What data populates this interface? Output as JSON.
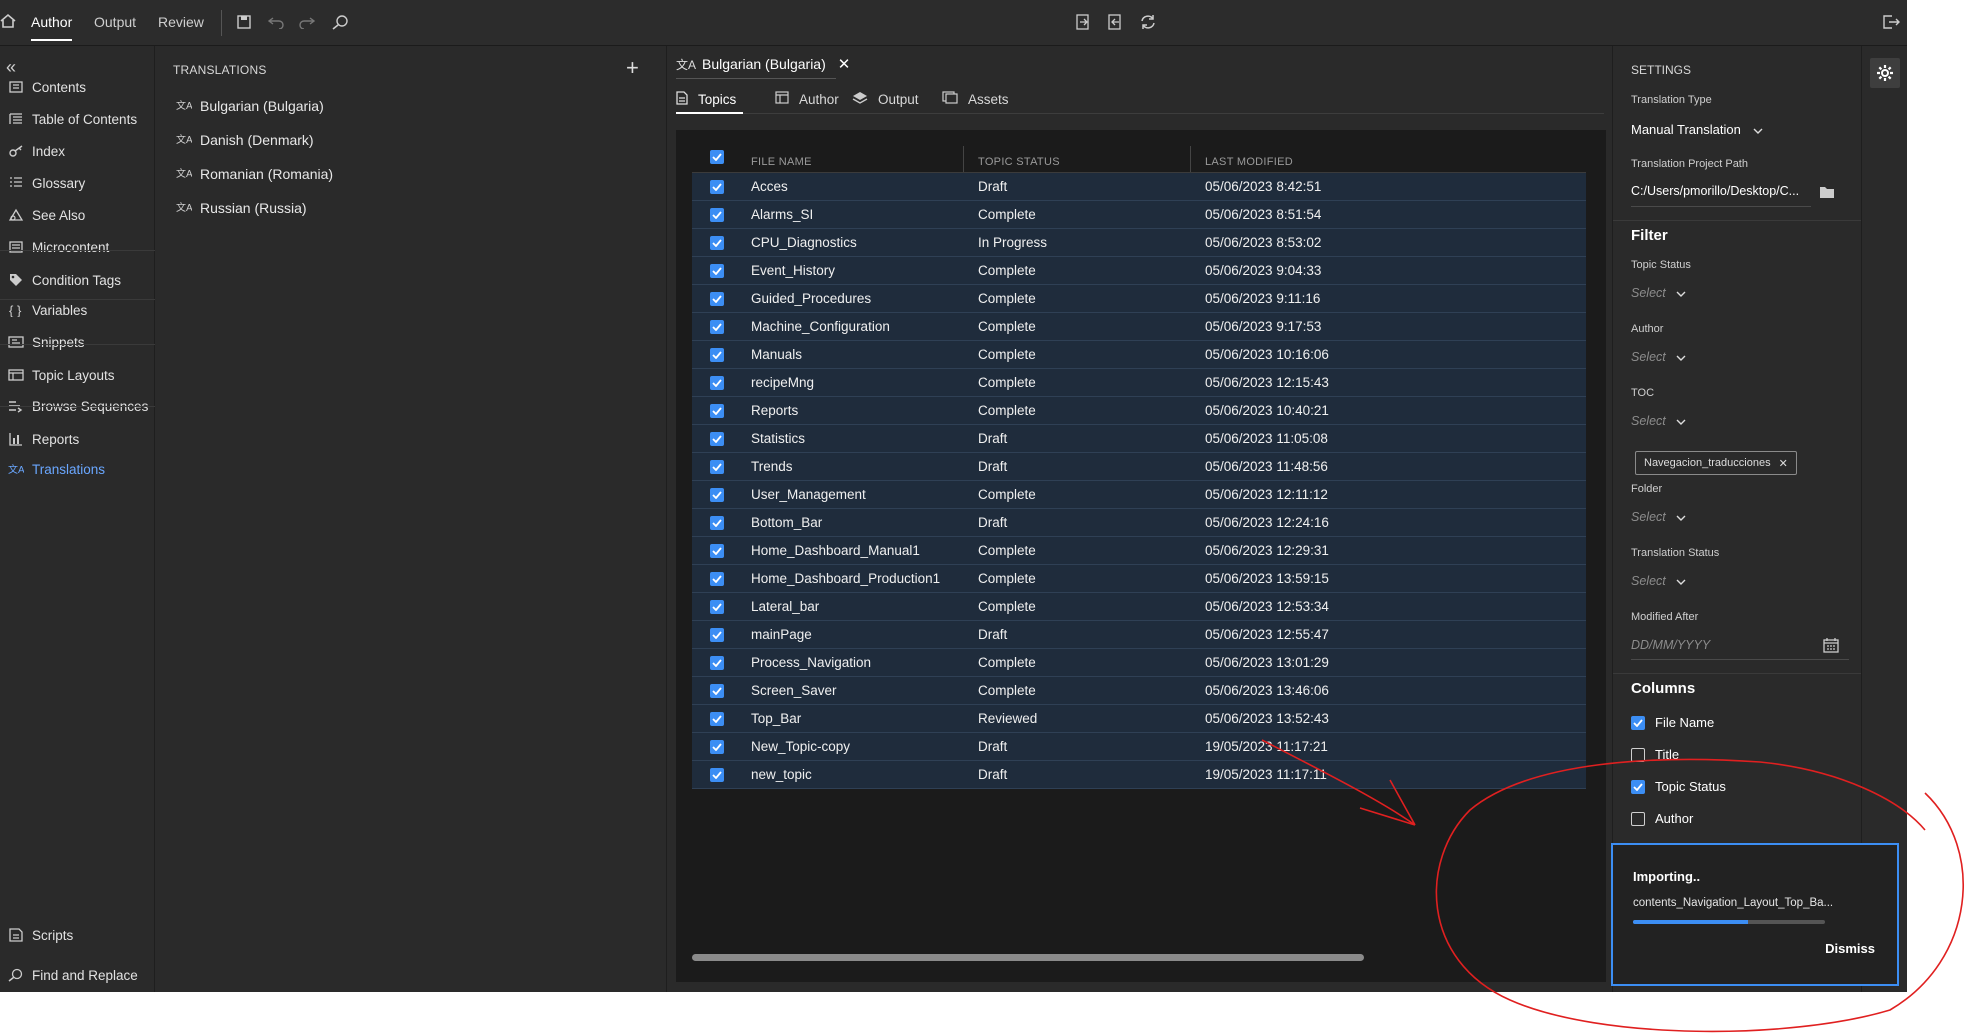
{
  "topbar": {
    "tabs": [
      "Author",
      "Output",
      "Review"
    ],
    "active_tab": "Author"
  },
  "leftnav": {
    "items": [
      {
        "label": "Contents",
        "icon": "contents-icon"
      },
      {
        "label": "Table of Contents",
        "icon": "toc-icon"
      },
      {
        "label": "Index",
        "icon": "index-icon"
      },
      {
        "label": "Glossary",
        "icon": "glossary-icon"
      },
      {
        "label": "See Also",
        "icon": "see-also-icon"
      },
      {
        "label": "Microcontent",
        "icon": "microcontent-icon"
      },
      {
        "label": "Condition Tags",
        "icon": "tag-icon"
      },
      {
        "label": "Variables",
        "icon": "variables-icon"
      },
      {
        "label": "Snippets",
        "icon": "snippets-icon"
      },
      {
        "label": "Topic Layouts",
        "icon": "layouts-icon"
      },
      {
        "label": "Browse Sequences",
        "icon": "sequence-icon"
      },
      {
        "label": "Reports",
        "icon": "reports-icon"
      },
      {
        "label": "Translations",
        "icon": "translate-icon"
      }
    ],
    "active": "Translations",
    "bottom_items": [
      {
        "label": "Scripts",
        "icon": "scripts-icon"
      },
      {
        "label": "Find and Replace",
        "icon": "find-replace-icon"
      }
    ]
  },
  "translations": {
    "heading": "TRANSLATIONS",
    "items": [
      "Bulgarian (Bulgaria)",
      "Danish (Denmark)",
      "Romanian (Romania)",
      "Russian (Russia)"
    ]
  },
  "center": {
    "doc_tab": "Bulgarian (Bulgaria)",
    "sub_tabs": [
      "Topics",
      "Author",
      "Output",
      "Assets"
    ],
    "active_sub_tab": "Topics",
    "columns": [
      "FILE NAME",
      "TOPIC STATUS",
      "LAST MODIFIED"
    ],
    "rows": [
      {
        "name": "Acces",
        "status": "Draft",
        "modified": "05/06/2023 8:42:51"
      },
      {
        "name": "Alarms_SI",
        "status": "Complete",
        "modified": "05/06/2023 8:51:54"
      },
      {
        "name": "CPU_Diagnostics",
        "status": "In Progress",
        "modified": "05/06/2023 8:53:02"
      },
      {
        "name": "Event_History",
        "status": "Complete",
        "modified": "05/06/2023 9:04:33"
      },
      {
        "name": "Guided_Procedures",
        "status": "Complete",
        "modified": "05/06/2023 9:11:16"
      },
      {
        "name": "Machine_Configuration",
        "status": "Complete",
        "modified": "05/06/2023 9:17:53"
      },
      {
        "name": "Manuals",
        "status": "Complete",
        "modified": "05/06/2023 10:16:06"
      },
      {
        "name": "recipeMng",
        "status": "Complete",
        "modified": "05/06/2023 12:15:43"
      },
      {
        "name": "Reports",
        "status": "Complete",
        "modified": "05/06/2023 10:40:21"
      },
      {
        "name": "Statistics",
        "status": "Draft",
        "modified": "05/06/2023 11:05:08"
      },
      {
        "name": "Trends",
        "status": "Draft",
        "modified": "05/06/2023 11:48:56"
      },
      {
        "name": "User_Management",
        "status": "Complete",
        "modified": "05/06/2023 12:11:12"
      },
      {
        "name": "Bottom_Bar",
        "status": "Draft",
        "modified": "05/06/2023 12:24:16"
      },
      {
        "name": "Home_Dashboard_Manual1",
        "status": "Complete",
        "modified": "05/06/2023 12:29:31"
      },
      {
        "name": "Home_Dashboard_Production1",
        "status": "Complete",
        "modified": "05/06/2023 13:59:15"
      },
      {
        "name": "Lateral_bar",
        "status": "Complete",
        "modified": "05/06/2023 12:53:34"
      },
      {
        "name": "mainPage",
        "status": "Draft",
        "modified": "05/06/2023 12:55:47"
      },
      {
        "name": "Process_Navigation",
        "status": "Complete",
        "modified": "05/06/2023 13:01:29"
      },
      {
        "name": "Screen_Saver",
        "status": "Complete",
        "modified": "05/06/2023 13:46:06"
      },
      {
        "name": "Top_Bar",
        "status": "Reviewed",
        "modified": "05/06/2023 13:52:43"
      },
      {
        "name": "New_Topic-copy",
        "status": "Draft",
        "modified": "19/05/2023 11:17:21"
      },
      {
        "name": "new_topic",
        "status": "Draft",
        "modified": "19/05/2023 11:17:11"
      }
    ]
  },
  "settings": {
    "heading": "SETTINGS",
    "translation_type_label": "Translation Type",
    "translation_type_value": "Manual Translation",
    "project_path_label": "Translation Project Path",
    "project_path_value": "C:/Users/pmorillo/Desktop/C...",
    "filter_heading": "Filter",
    "topic_status_label": "Topic Status",
    "author_label": "Author",
    "toc_label": "TOC",
    "folder_label": "Folder",
    "translation_status_label": "Translation Status",
    "select_placeholder": "Select",
    "toc_chip": "Navegacion_traducciones",
    "modified_after_label": "Modified After",
    "date_placeholder": "DD/MM/YYYY",
    "columns_heading": "Columns",
    "columns": [
      {
        "label": "File Name",
        "checked": true
      },
      {
        "label": "Title",
        "checked": false
      },
      {
        "label": "Topic Status",
        "checked": true
      },
      {
        "label": "Author",
        "checked": false
      }
    ]
  },
  "toast": {
    "title": "Importing..",
    "file": "contents_Navigation_Layout_Top_Ba...",
    "progress": 0.6,
    "dismiss": "Dismiss"
  },
  "colors": {
    "accent": "#3c8ef4",
    "active_nav": "#6aa7ff",
    "annotation": "#e02020"
  }
}
